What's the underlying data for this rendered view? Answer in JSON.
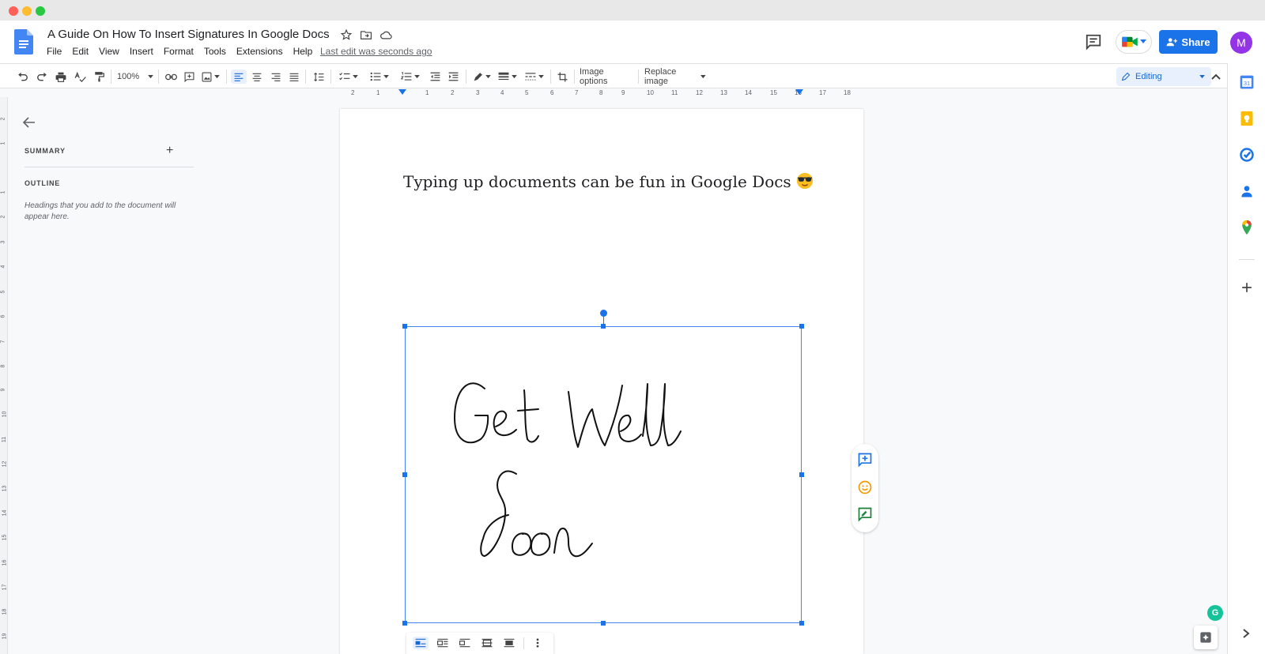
{
  "document": {
    "title": "A Guide On How To Insert Signatures In Google Docs",
    "last_edit": "Last edit was seconds ago",
    "body_text": "Typing up documents can be fun in Google Docs",
    "image_text": "Get Well Soon"
  },
  "menu": [
    "File",
    "Edit",
    "View",
    "Insert",
    "Format",
    "Tools",
    "Extensions",
    "Help"
  ],
  "header": {
    "share_label": "Share",
    "avatar_initial": "M"
  },
  "toolbar": {
    "zoom": "100%",
    "image_options": "Image options",
    "replace_image": "Replace image",
    "mode": "Editing"
  },
  "ruler": {
    "horizontal_ticks": [
      "2",
      "1",
      "1",
      "2",
      "3",
      "4",
      "5",
      "6",
      "7",
      "8",
      "9",
      "10",
      "11",
      "12",
      "13",
      "14",
      "15",
      "16",
      "17",
      "18"
    ],
    "vertical_ticks": [
      "2",
      "1",
      "1",
      "2",
      "3",
      "4",
      "5",
      "6",
      "7",
      "8",
      "9",
      "10",
      "11",
      "12",
      "13",
      "14",
      "15",
      "16",
      "17",
      "18",
      "19"
    ]
  },
  "outline_panel": {
    "summary_label": "SUMMARY",
    "add_symbol": "+",
    "outline_label": "OUTLINE",
    "outline_hint": "Headings that you add to the document will appear here."
  },
  "extras": {
    "grammarly_label": "G"
  },
  "colors": {
    "accent": "#1a73e8",
    "avatar": "#9334e6",
    "grammarly": "#15c39a"
  },
  "icons": {
    "rail": [
      "calendar-icon",
      "keep-icon",
      "tasks-icon",
      "contacts-icon",
      "maps-icon",
      "add-icon"
    ],
    "side_actions": [
      "add-comment-icon",
      "emoji-reaction-icon",
      "suggest-edits-icon"
    ]
  }
}
